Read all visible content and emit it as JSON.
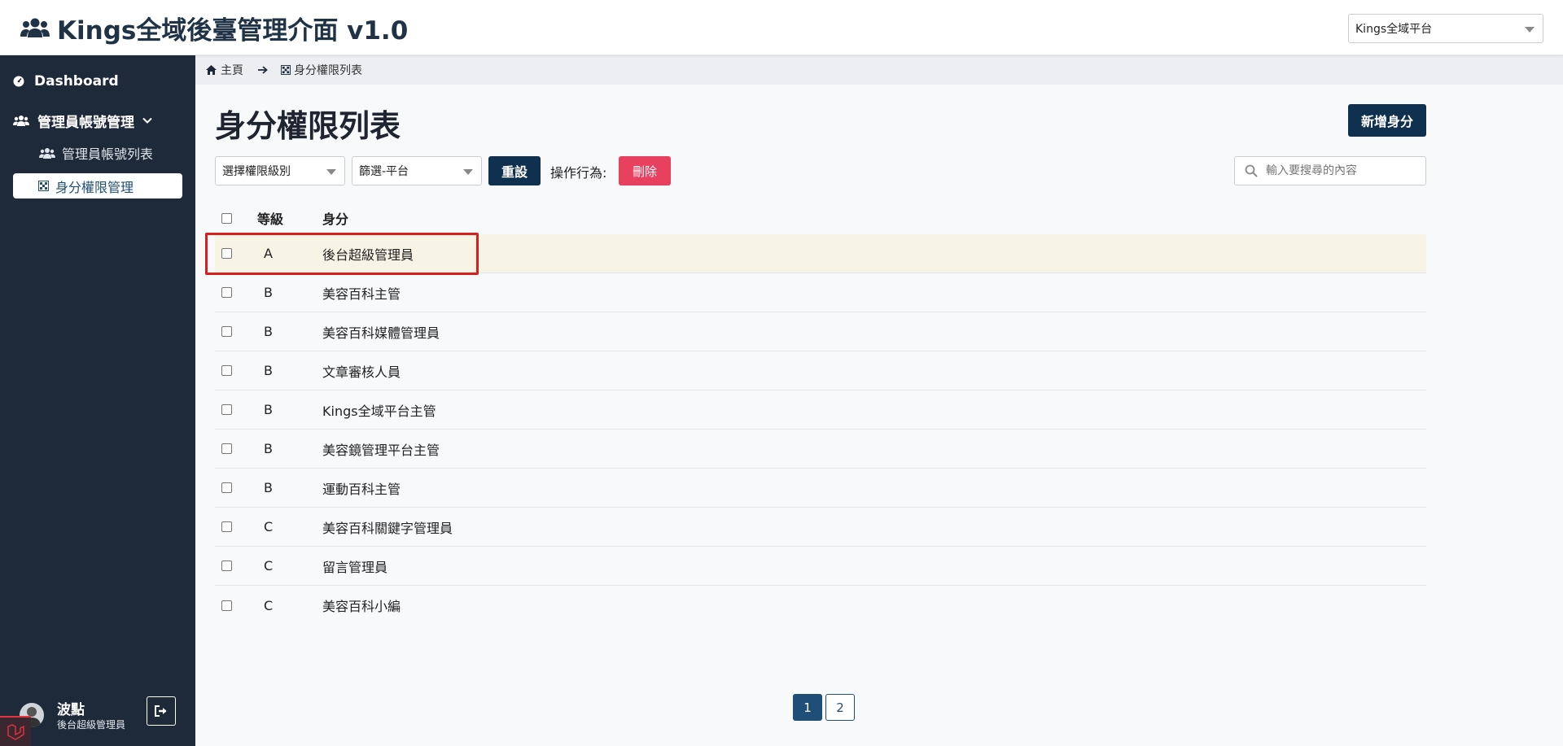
{
  "app": {
    "title": "Kings全域後臺管理介面 v1.0"
  },
  "header": {
    "platform_select": "Kings全域平台"
  },
  "sidebar": {
    "dashboard": "Dashboard",
    "admin_group": "管理員帳號管理",
    "admin_list": "管理員帳號列表",
    "role_mgmt": "身分權限管理"
  },
  "user": {
    "name": "波點",
    "role": "後台超級管理員"
  },
  "breadcrumb": {
    "home": "主頁",
    "current": "身分權限列表"
  },
  "page": {
    "title": "身分權限列表",
    "add_button": "新增身分"
  },
  "filters": {
    "level_select": "選擇權限級別",
    "platform_select": "篩選-平台",
    "reset_button": "重設",
    "action_label": "操作行為:",
    "delete_button": "刪除",
    "search_placeholder": "輸入要搜尋的內容"
  },
  "table": {
    "headers": {
      "level": "等級",
      "role": "身分"
    },
    "rows": [
      {
        "level": "A",
        "role": "後台超級管理員"
      },
      {
        "level": "B",
        "role": "美容百科主管"
      },
      {
        "level": "B",
        "role": "美容百科媒體管理員"
      },
      {
        "level": "B",
        "role": "文章審核人員"
      },
      {
        "level": "B",
        "role": "Kings全域平台主管"
      },
      {
        "level": "B",
        "role": "美容鏡管理平台主管"
      },
      {
        "level": "B",
        "role": "運動百科主管"
      },
      {
        "level": "C",
        "role": "美容百科關鍵字管理員"
      },
      {
        "level": "C",
        "role": "留言管理員"
      },
      {
        "level": "C",
        "role": "美容百科小編"
      }
    ]
  },
  "pagination": {
    "pages": [
      "1",
      "2"
    ],
    "current": "1"
  },
  "colors": {
    "sidebar": "#1e2a3a",
    "primary": "#10304f",
    "danger": "#e8405f",
    "highlight": "#d81f1f"
  }
}
